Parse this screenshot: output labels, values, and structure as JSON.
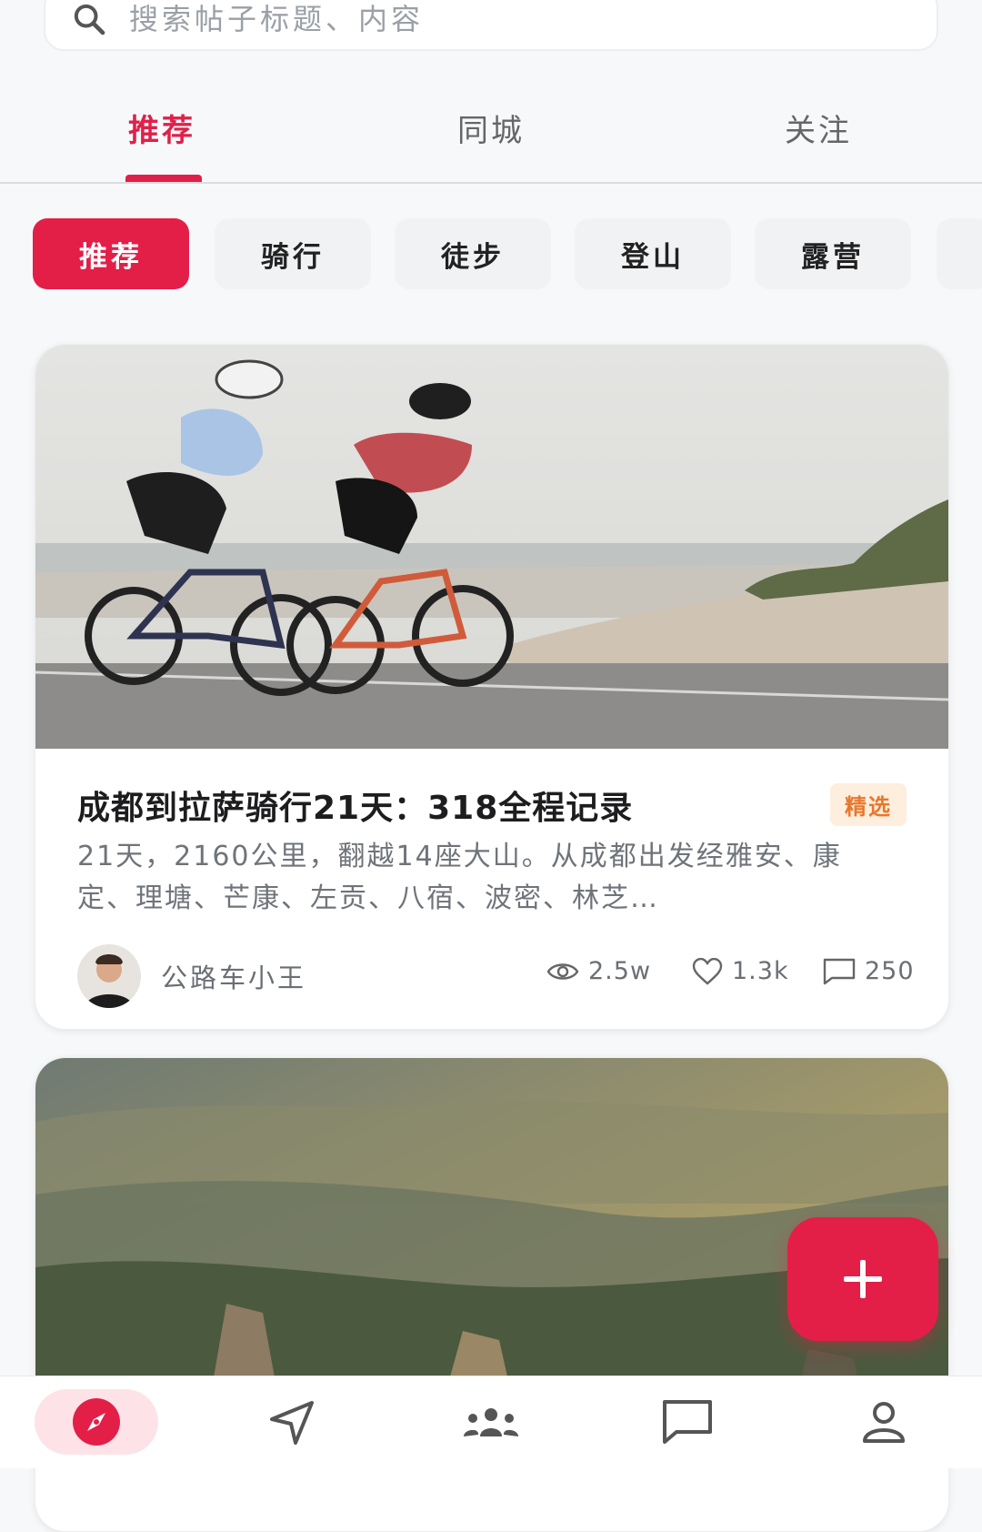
{
  "search": {
    "placeholder": "搜索帖子标题、内容",
    "icon": "search-icon"
  },
  "tabs": [
    {
      "label": "推荐",
      "active": true
    },
    {
      "label": "同城",
      "active": false
    },
    {
      "label": "关注",
      "active": false
    }
  ],
  "categories": [
    {
      "label": "推荐",
      "active": true
    },
    {
      "label": "骑行",
      "active": false
    },
    {
      "label": "徒步",
      "active": false
    },
    {
      "label": "登山",
      "active": false
    },
    {
      "label": "露营",
      "active": false
    }
  ],
  "posts": [
    {
      "title": "成都到拉萨骑行21天：318全程记录",
      "badge": "精选",
      "excerpt": "21天，2160公里，翻越14座大山。从成都出发经雅安、康定、理塘、芒康、左贡、八宿、波密、林芝…",
      "author": "公路车小王",
      "views": "2.5w",
      "likes": "1.3k",
      "comments": "250"
    }
  ],
  "fab": {
    "icon": "plus-icon"
  },
  "bottom_nav": [
    "compass-icon",
    "send-icon",
    "group-icon",
    "message-icon",
    "profile-icon"
  ],
  "colors": {
    "accent": "#e31f48",
    "badge_bg": "#fdeede",
    "badge_text": "#e8772b"
  }
}
